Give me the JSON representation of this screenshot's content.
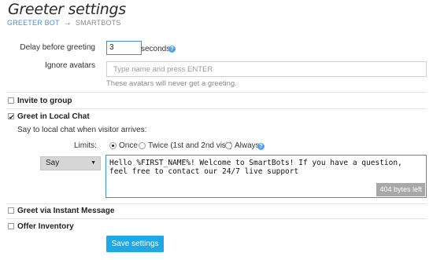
{
  "page": {
    "title": "Greeter settings",
    "breadcrumb": {
      "parent": "GREETER BOT",
      "arrow": "→",
      "current": "SMARTBOTS"
    }
  },
  "delay": {
    "label": "Delay before greeting",
    "value": "3",
    "unit": "seconds"
  },
  "ignore_avatars": {
    "label": "Ignore avatars",
    "placeholder": "Type name and press ENTER",
    "hint": "These avatars will never get a greeting."
  },
  "invite_group": {
    "label": "Invite to group",
    "checked": false
  },
  "local_chat": {
    "label": "Greet in Local Chat",
    "checked": true,
    "description": "Say to local chat when visitor arrives:",
    "limits_label": "Limits:",
    "limits_options": [
      {
        "label": "Once",
        "selected": true
      },
      {
        "label": "Twice (1st and 2nd visit)",
        "selected": false
      },
      {
        "label": "Always",
        "selected": false
      }
    ],
    "mode_select": "Say",
    "message": "Hello %FIRST_NAME%! Welcome to SmartBots! If you have a question, feel free to contact our 24/7 live support",
    "bytes_left": "404 bytes left"
  },
  "instant_message": {
    "label": "Greet via Instant Message",
    "checked": false
  },
  "offer_inventory": {
    "label": "Offer Inventory",
    "checked": false
  },
  "save_button": "Save settings",
  "colors": {
    "accent": "#1ea8e6",
    "link": "#4a8fd6",
    "focus_border": "#3c8fe0"
  },
  "icons": {
    "help": "help-icon",
    "check": "checkmark-icon",
    "caret": "chevron-down-icon"
  }
}
